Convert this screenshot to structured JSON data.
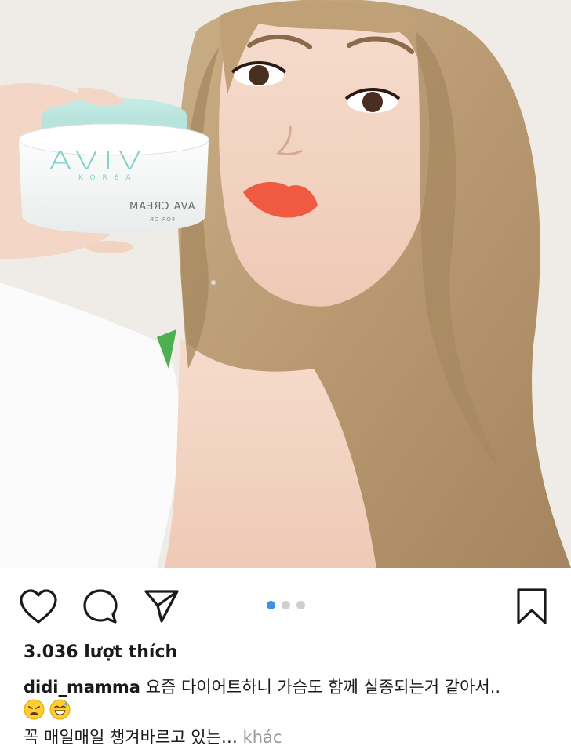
{
  "post": {
    "product": {
      "brand_logo": "AVIV",
      "brand_sub": "KOREA",
      "product_name": "AVA CREAM",
      "product_sub": "FOR DR"
    },
    "actions": {
      "like_icon": "heart-icon",
      "comment_icon": "comment-icon",
      "share_icon": "paper-plane-icon",
      "save_icon": "bookmark-icon"
    },
    "carousel": {
      "total": 3,
      "current": 1,
      "active_color": "#3d8fe8",
      "inactive_color": "#cfcfcf"
    },
    "likes_text": "3.036 lượt thích",
    "caption": {
      "username": "didi_mamma",
      "text_line1": " 요즘 다이어트하니 가슴도 함께 실종되는거 같아서..",
      "emojis": [
        "weary-face-emoji",
        "grinning-sweat-emoji"
      ],
      "text_line3": "꼭 매일매일 챙겨바르고 있는…",
      "more_label": " khác"
    }
  }
}
